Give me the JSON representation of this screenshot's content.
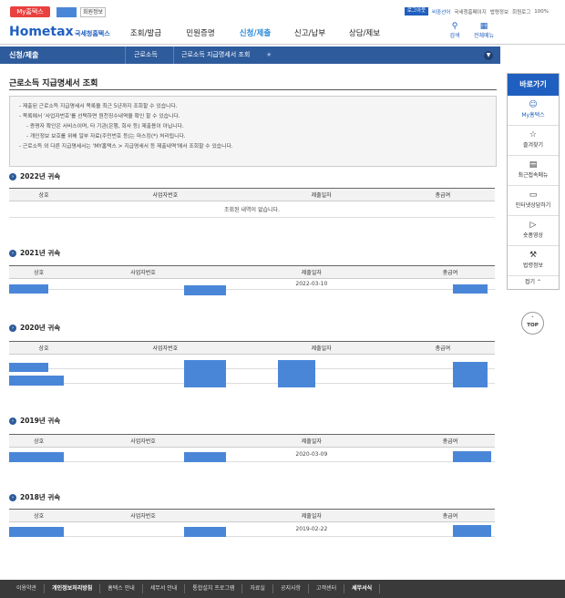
{
  "header": {
    "my_hometax": "My홈택스",
    "member_info": "회원정보",
    "logout": "로그아웃",
    "remaining_time": "비중선어",
    "util_links": [
      "국세청홈페이지",
      "법령정보",
      "회원로그"
    ],
    "zoom": "100%",
    "logo_text": "Hometax",
    "logo_subtext": "국세청홈택스",
    "nav": [
      "조회/발급",
      "민원증명",
      "신청/제출",
      "신고/납부",
      "상담/제보"
    ],
    "nav_active": "신청/제출",
    "search_label": "검색",
    "all_menu_label": "전체메뉴"
  },
  "subbar": {
    "home": "신청/제출",
    "crumb1": "근로소득",
    "crumb2": "근로소득 지급명세서 조회"
  },
  "page": {
    "title": "근로소득 지급명세서 조회",
    "notice": [
      "- 제출된 근로소득 지급명세서 목록을 최근 5년까지 조회할 수 있습니다.",
      "- 목록에서 '사업자번호'를 선택하면 원천징수내역을 확인 할 수 있습니다.",
      "- 증명자 확인은 서비스이며, 타 기관(은행, 회사 등) 제출용이 아닙니다.",
      "- 개인정보 보호를 위해 일부 자료(주민번호 등)는 마스킹(*) 처리됩니다.",
      "- 근로소득 외 다른 지급명세서는 'MY홈택스 > 지급명세서 등 제출내역'에서 조회할 수 있습니다."
    ],
    "notice_highlight_1": "'사업자번호'",
    "notice_highlight_2": "원천징수내역"
  },
  "table_headers": [
    "상호",
    "사업자번호",
    "제출일자",
    "총급여"
  ],
  "sections": [
    {
      "title": "2022년 귀속",
      "empty_text": "조회된 내역이 없습니다."
    },
    {
      "title": "2021년 귀속",
      "date": "2022-03-10"
    },
    {
      "title": "2020년 귀속"
    },
    {
      "title": "2019년 귀속",
      "date": "2020-03-09"
    },
    {
      "title": "2018년 귀속",
      "date": "2019-02-22"
    }
  ],
  "quick_menu": {
    "title": "바로가기",
    "items": [
      {
        "label": "My홈택스",
        "icon": "person-icon"
      },
      {
        "label": "즐겨찾기",
        "icon": "star-icon"
      },
      {
        "label": "최근접속메뉴",
        "icon": "recent-icon"
      },
      {
        "label": "인터넷상담하기",
        "icon": "laptop-icon"
      },
      {
        "label": "숏폼영상",
        "icon": "play-icon"
      },
      {
        "label": "법령정보",
        "icon": "gavel-icon"
      }
    ],
    "fold": "접기",
    "top": "TOP"
  },
  "footer": [
    "이용약관",
    "개인정보처리방침",
    "홈택스 안내",
    "세무서 안내",
    "통합설치 프로그램",
    "자료실",
    "공지사항",
    "고객센터",
    "세무서식"
  ]
}
